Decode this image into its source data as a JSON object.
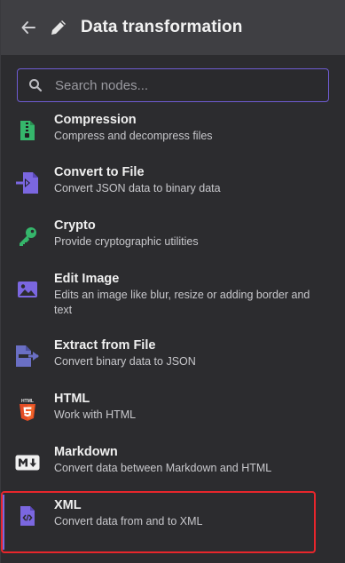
{
  "header": {
    "title": "Data transformation"
  },
  "search": {
    "placeholder": "Search nodes..."
  },
  "nodes": [
    {
      "name": "Compression",
      "description": "Compress and decompress files"
    },
    {
      "name": "Convert to File",
      "description": "Convert JSON data to binary data"
    },
    {
      "name": "Crypto",
      "description": "Provide cryptographic utilities"
    },
    {
      "name": "Edit Image",
      "description": "Edits an image like blur, resize or adding border and text"
    },
    {
      "name": "Extract from File",
      "description": "Convert binary data to JSON"
    },
    {
      "name": "HTML",
      "description": "Work with HTML"
    },
    {
      "name": "Markdown",
      "description": "Convert data between Markdown and HTML"
    },
    {
      "name": "XML",
      "description": "Convert data from and to XML"
    }
  ],
  "icons": {
    "back": "arrow-left-icon",
    "header": "pencil-icon",
    "search": "search-icon",
    "compression": "file-archive-icon",
    "convert_to_file": "file-import-icon",
    "crypto": "key-icon",
    "edit_image": "image-icon",
    "extract_from_file": "file-export-icon",
    "html": "html5-icon",
    "markdown": "markdown-icon",
    "xml": "file-code-icon"
  },
  "colors": {
    "accent": "#7b67e0",
    "highlight": "#e8262c",
    "green": "#35b66b",
    "purple": "#7b67e0",
    "html_orange": "#e44d26"
  }
}
